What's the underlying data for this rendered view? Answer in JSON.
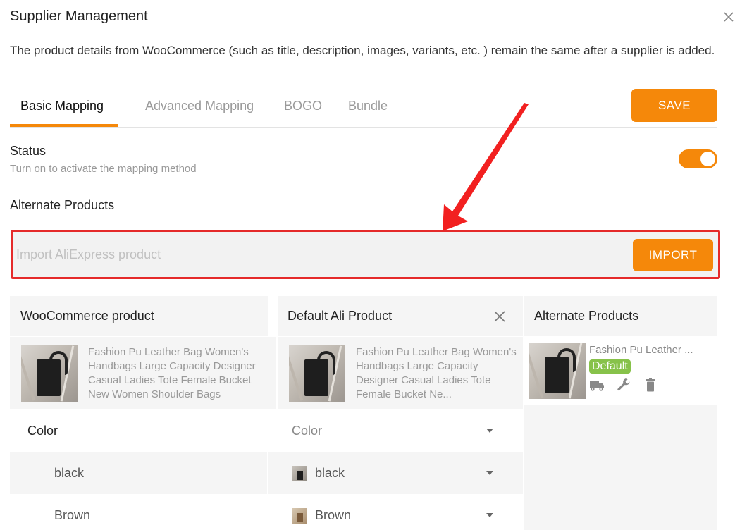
{
  "dialog": {
    "title": "Supplier Management",
    "description": "The product details from WooCommerce (such as title, description, images, variants, etc. ) remain the same after a supplier is added."
  },
  "tabs": [
    {
      "label": "Basic Mapping",
      "active": true
    },
    {
      "label": "Advanced Mapping",
      "active": false
    },
    {
      "label": "BOGO",
      "active": false
    },
    {
      "label": "Bundle",
      "active": false
    }
  ],
  "save_label": "SAVE",
  "status": {
    "title": "Status",
    "subtitle": "Turn on to activate the mapping method",
    "enabled": true
  },
  "alternate": {
    "title": "Alternate Products",
    "import_placeholder": "Import AliExpress product",
    "import_label": "IMPORT"
  },
  "table": {
    "headers": {
      "woo": "WooCommerce product",
      "default_ali": "Default Ali Product",
      "alternate": "Alternate Products"
    },
    "woo_product": "Fashion Pu Leather Bag Women's Handbags Large Capacity Designer Casual Ladies Tote Female Bucket New Women Shoulder Bags",
    "ali_product": "Fashion Pu Leather Bag Women's Handbags Large Capacity Designer Casual Ladies Tote Female Bucket Ne...",
    "alt_product": {
      "name": "Fashion Pu Leather ...",
      "badge": "Default",
      "icons": [
        "truck-icon",
        "wrench-icon",
        "trash-icon"
      ]
    }
  },
  "mapping": {
    "attribute_label": "Color",
    "attribute_select": "Color",
    "rows": [
      {
        "woo": "black",
        "ali": "black"
      },
      {
        "woo": "Brown",
        "ali": "Brown"
      }
    ]
  },
  "colors": {
    "accent": "#f5880a",
    "highlight_border": "#e52a2a",
    "badge": "#87c24a"
  }
}
